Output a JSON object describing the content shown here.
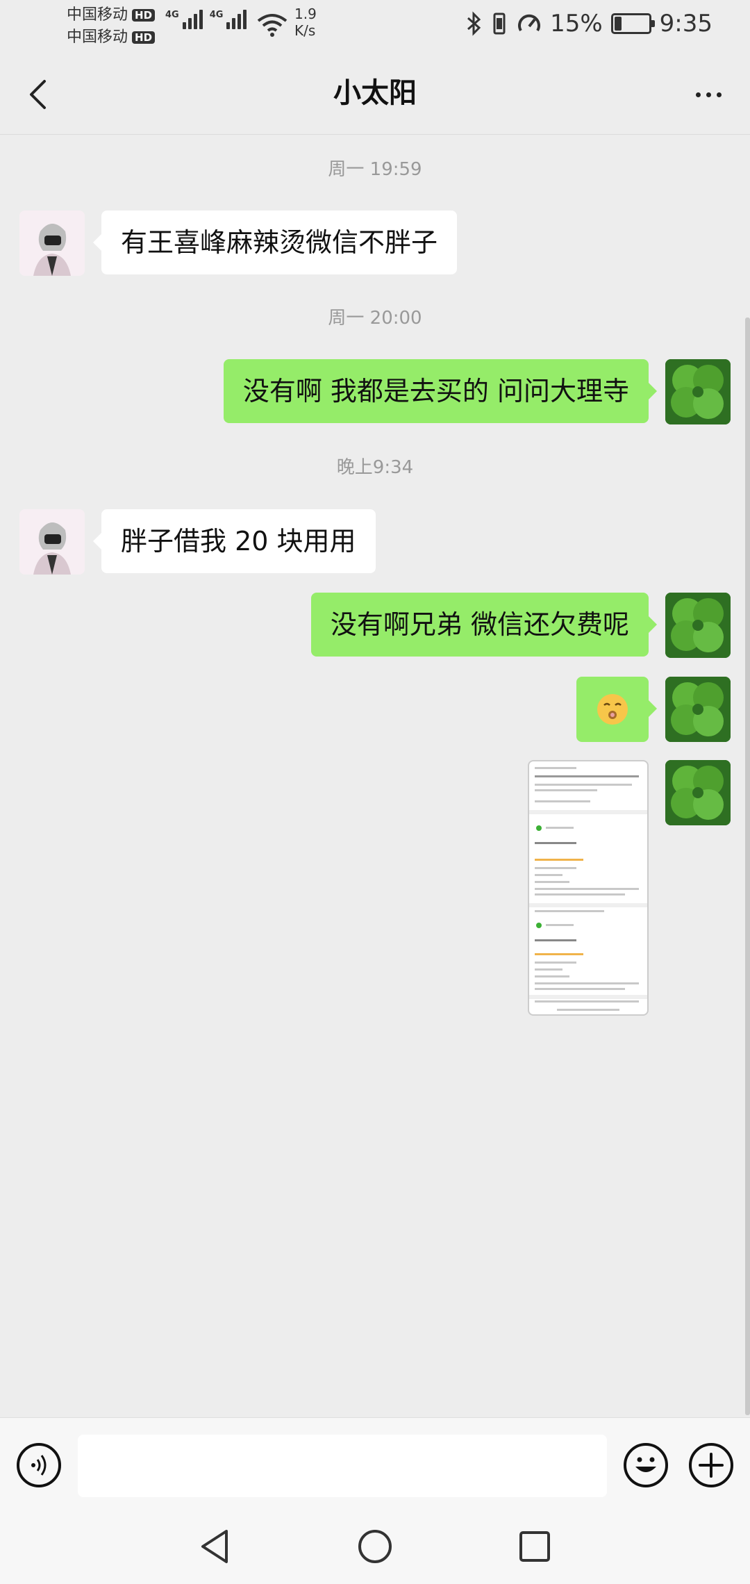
{
  "status_bar": {
    "carrier_1": "中国移动",
    "carrier_2": "中国移动",
    "hd_badge": "HD",
    "network_type": "4G",
    "speed_value": "1.9",
    "speed_unit": "K/s",
    "battery_percent": "15%",
    "clock": "9:35"
  },
  "header": {
    "title": "小太阳",
    "back_icon": "chevron-left-icon",
    "more_icon": "more-horizontal-icon"
  },
  "messages": {
    "time_1": "周一 19:59",
    "msg_1": "有王喜峰麻辣烫微信不胖子",
    "time_2": "周一 20:00",
    "msg_2": "没有啊 我都是去买的 问问大理寺",
    "time_3": "晚上9:34",
    "msg_3": "胖子借我 20 块用用",
    "msg_4": "没有啊兄弟 微信还欠费呢"
  },
  "input_bar": {
    "voice_icon": "voice-icon",
    "emoji_icon": "smiley-icon",
    "plus_icon": "plus-circle-icon",
    "input_value": ""
  },
  "nav_bar": {
    "back_icon": "triangle-back-icon",
    "home_icon": "circle-home-icon",
    "recents_icon": "square-recents-icon"
  },
  "colors": {
    "background": "#ededed",
    "outgoing_bubble": "#95ec69",
    "incoming_bubble": "#ffffff",
    "timestamp_text": "#999999"
  }
}
